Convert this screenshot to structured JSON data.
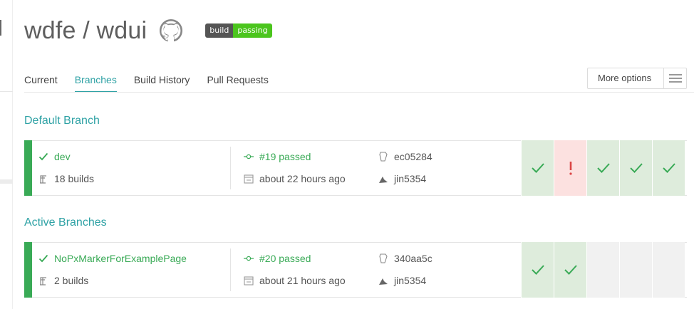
{
  "repo": {
    "title": "wdfe / wdui"
  },
  "badge": {
    "left": "build",
    "right": "passing"
  },
  "tabs": [
    {
      "label": "Current",
      "active": false
    },
    {
      "label": "Branches",
      "active": true
    },
    {
      "label": "Build History",
      "active": false
    },
    {
      "label": "Pull Requests",
      "active": false
    }
  ],
  "more_options": {
    "label": "More options"
  },
  "default_section": {
    "title": "Default Branch",
    "branch": {
      "name": "dev",
      "builds": "18 builds",
      "last_build": "#19 passed",
      "time": "about 22 hours ago",
      "commit": "ec05284",
      "author": "jin5354",
      "history": [
        "passed",
        "failed",
        "passed",
        "passed",
        "passed"
      ]
    }
  },
  "active_section": {
    "title": "Active Branches",
    "branch": {
      "name": "NoPxMarkerForExamplePage",
      "builds": "2 builds",
      "last_build": "#20 passed",
      "time": "about 21 hours ago",
      "commit": "340aa5c",
      "author": "jin5354",
      "history": [
        "passed",
        "passed",
        "empty",
        "empty",
        "empty"
      ]
    }
  },
  "colors": {
    "accent": "#2fa2a5",
    "passed": "#39aa56",
    "failed": "#db4545"
  },
  "icons": {
    "github": "github-icon",
    "check": "check-icon",
    "builds": "builds-icon",
    "commit": "commit-icon",
    "calendar": "calendar-icon",
    "branch": "branch-icon",
    "author": "author-icon"
  }
}
